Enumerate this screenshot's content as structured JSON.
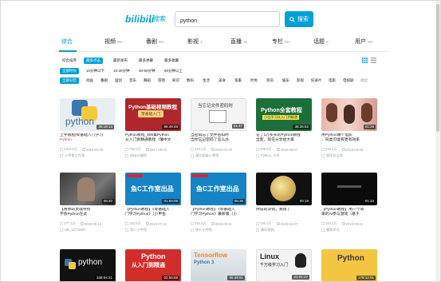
{
  "header": {
    "logo_text": "bilibili",
    "logo_sub": "搜索",
    "search_value": "python",
    "search_button": "搜索"
  },
  "tabs": [
    {
      "label": "综合",
      "count": ""
    },
    {
      "label": "视频",
      "count": "99+"
    },
    {
      "label": "番剧",
      "count": "99+"
    },
    {
      "label": "影视",
      "count": "1"
    },
    {
      "label": "直播",
      "count": "15"
    },
    {
      "label": "专栏",
      "count": "99+"
    },
    {
      "label": "话题",
      "count": "0"
    },
    {
      "label": "用户",
      "count": "99+"
    }
  ],
  "sort": [
    "综合排序",
    "最多点击",
    "最新发布",
    "最多弹幕",
    "最多收藏"
  ],
  "duration": [
    "全部时长",
    "10分钟以下",
    "10-30分钟",
    "30-60分钟",
    "60分钟以上"
  ],
  "zones": [
    "全部分区",
    "动画",
    "番剧",
    "国创",
    "音乐",
    "舞蹈",
    "游戏",
    "知识",
    "数码",
    "生活",
    "美食",
    "鬼畜",
    "时尚",
    "资讯",
    "娱乐",
    "影视",
    "纪录片",
    "电影",
    "电视剧",
    "收起"
  ],
  "cards": [
    {
      "title_pre": "上手教程",
      "title_hl": "",
      "title_rest": "",
      "line1": "上手教程|零基础入门学习",
      "line2": "Python",
      "line2_hl": true,
      "duration": "36:16:13",
      "views": "1310.5万",
      "date": "2019-03-09",
      "uploader": "小甲鱼工作室",
      "thumb_text": "python",
      "thumb_style": "python-logo"
    },
    {
      "line1": "Python教程_600集Python",
      "line2": "从入门到精通教程（懂中文",
      "duration": "56:49:48",
      "views": "792.0万",
      "date": "2017-05-03",
      "uploader": "尚硅谷编程",
      "thumb_text": "Python基础视频教程",
      "thumb_sub": "零基础入门",
      "thumb_style": "red"
    },
    {
      "line1": "当密码忘了文件密码时",
      "line2": "当你忘记密码了怎么办",
      "duration": "01:47",
      "views": "223.1万",
      "date": "2020-01-03",
      "uploader": "瑞尔超级小课堂",
      "thumb_text": "当忘记文件密码时",
      "thumb_style": "doc"
    },
    {
      "line1": "花了1万多买的Python教程",
      "line2": "全套，现在分享给大家",
      "duration": "38:36:52",
      "views": "306.5万",
      "date": "2020-08-07",
      "uploader": "Python_子木",
      "thumb_text": "Python全套教程",
      "thumb_sub": "小白学习从入门到精通",
      "thumb_style": "green"
    },
    {
      "line1": "用Python做个电影",
      "line2": "，同类可能有更有效率",
      "duration": "01:29",
      "views": "226.2万",
      "date": "2019-06-06",
      "uploader": "程序员日常",
      "thumb_text": "",
      "thumb_style": "photo"
    },
    {
      "line1": "【用你的灵魂寻找",
      "line2": "学会Python在此",
      "duration": "06:40",
      "views": "177.1万",
      "date": "2019-05-14",
      "uploader": "SB_13719997",
      "thumb_text": "",
      "thumb_style": "portrait"
    },
    {
      "line1": "【Python教程】《零基础入",
      "line2": "门学习Python》（小甲鱼",
      "duration": "01:56:09",
      "views": "152.5万",
      "date": "2018-07-26",
      "uploader": "鱼C-小甲鱼",
      "thumb_text": "鱼C工作室出品",
      "thumb_style": "blue-fc"
    },
    {
      "line1": "【Python教程】《零基础入",
      "line2": "门学习Python》最新版（小",
      "duration": "05:36",
      "views": "152.3万",
      "date": "2019-05-11",
      "uploader": "鱼C-小甲鱼",
      "thumb_text": "鱼C工作室出品",
      "thumb_style": "blue-fc"
    },
    {
      "line1": "你说的没错，我错了",
      "line2": "",
      "duration": "00:18",
      "views": "140.2万",
      "date": "2020-04-07",
      "uploader": "美时视频",
      "thumb_text": "",
      "thumb_style": "moon"
    },
    {
      "line1": "【Python教程】用一个简",
      "line2": "单的AI参与游戏（基于",
      "duration": "01:34",
      "views": "143.2万",
      "date": "2019-08-24",
      "uploader": "墨影伊凡",
      "thumb_text": "",
      "thumb_style": "dark"
    },
    {
      "line1": "",
      "line2": "",
      "duration": "338:04:21",
      "views": "",
      "date": "",
      "uploader": "",
      "thumb_text": "python",
      "thumb_style": "black-python"
    },
    {
      "line1": "",
      "line2": "",
      "duration": "02:56:58",
      "views": "",
      "date": "",
      "uploader": "",
      "thumb_text": "Python",
      "thumb_sub": "从入门到精通",
      "thumb_style": "red2"
    },
    {
      "line1": "",
      "line2": "",
      "duration": "95:49:51",
      "views": "",
      "date": "",
      "uploader": "",
      "thumb_text": "Tensorflow",
      "thumb_sub": "Python 3",
      "thumb_style": "tf"
    },
    {
      "line1": "",
      "line2": "",
      "duration": "21:01:17",
      "views": "",
      "date": "",
      "uploader": "",
      "thumb_text": "Linux",
      "thumb_sub": "千万级学习入门",
      "thumb_style": "linux"
    },
    {
      "line1": "",
      "line2": "",
      "duration": "179:12:01",
      "views": "",
      "date": "",
      "uploader": "",
      "thumb_text": "Python",
      "thumb_style": "yellow"
    }
  ],
  "colors": {
    "accent": "#00a1d6",
    "highlight": "#e5433b"
  }
}
